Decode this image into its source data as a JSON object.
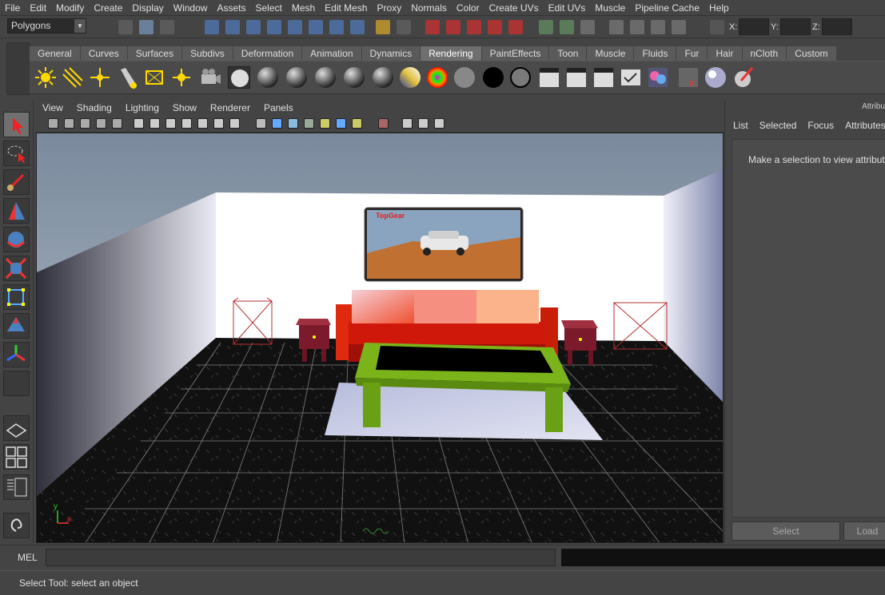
{
  "menubar": {
    "items": [
      "File",
      "Edit",
      "Modify",
      "Create",
      "Display",
      "Window",
      "Assets",
      "Select",
      "Mesh",
      "Edit Mesh",
      "Proxy",
      "Normals",
      "Color",
      "Create UVs",
      "Edit UVs",
      "Muscle",
      "Pipeline Cache",
      "Help"
    ]
  },
  "status_line": {
    "mode": "Polygons",
    "x_label": "X:",
    "y_label": "Y:",
    "z_label": "Z:"
  },
  "shelf": {
    "tabs": [
      "General",
      "Curves",
      "Surfaces",
      "Subdivs",
      "Deformation",
      "Animation",
      "Dynamics",
      "Rendering",
      "PaintEffects",
      "Toon",
      "Muscle",
      "Fluids",
      "Fur",
      "Hair",
      "nCloth",
      "Custom"
    ],
    "active_tab": "Rendering"
  },
  "viewport": {
    "menu": [
      "View",
      "Shading",
      "Lighting",
      "Show",
      "Renderer",
      "Panels"
    ],
    "poster_text": "TopGear",
    "axis_y": "y",
    "axis_x": "x"
  },
  "attribute_editor": {
    "header": "Attribu",
    "menu": [
      "List",
      "Selected",
      "Focus",
      "Attributes"
    ],
    "message": "Make a selection to view attributes",
    "select_button": "Select",
    "load_button": "Load"
  },
  "command_line": {
    "label": "MEL"
  },
  "help_line": {
    "text": "Select Tool: select an object"
  },
  "colors": {
    "sofa": "#d62a10",
    "table": "#7ab31a",
    "ui_bg": "#444444",
    "selected_tab": "#6f6f6f"
  }
}
